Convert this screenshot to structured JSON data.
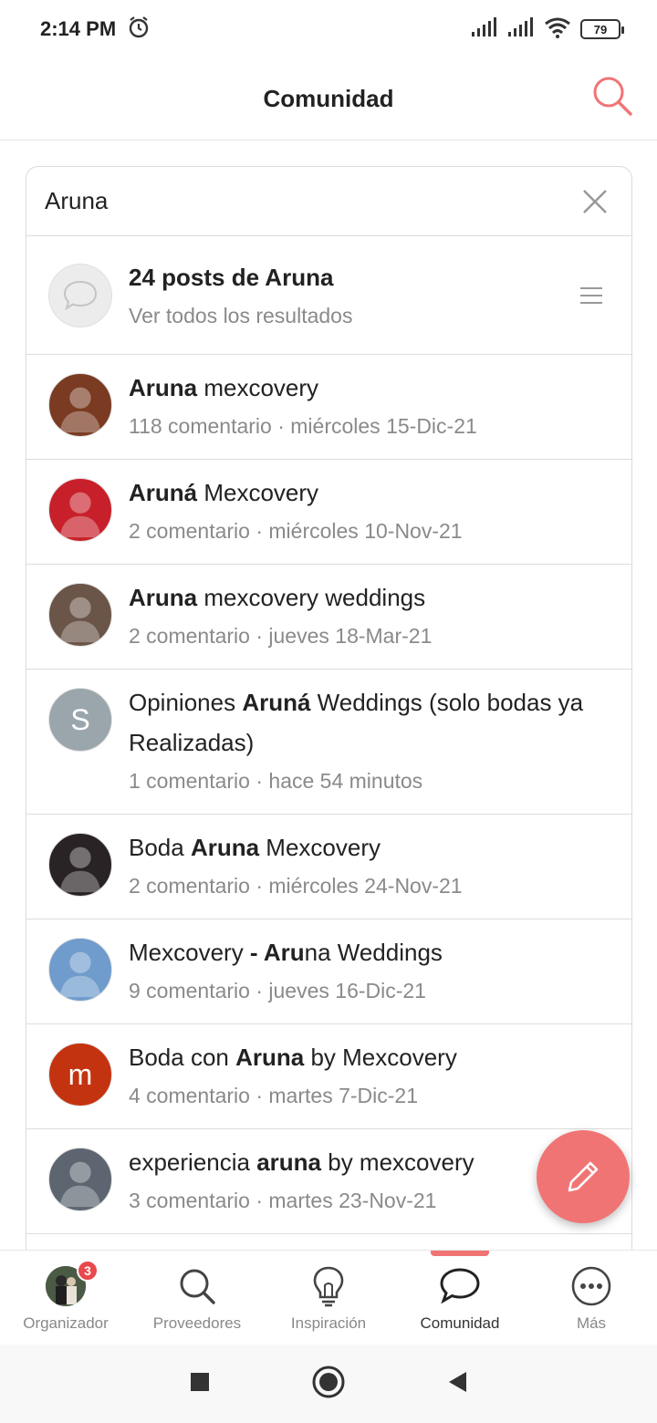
{
  "status_bar": {
    "time": "2:14 PM",
    "battery": "79"
  },
  "header": {
    "title": "Comunidad"
  },
  "search": {
    "value": "Aruna"
  },
  "posts_summary": {
    "title": "24 posts de Aruna",
    "subtitle": "Ver todos los resultados"
  },
  "results": [
    {
      "pre": "",
      "bold": "Aruna",
      "post": " mexcovery",
      "meta": "118 comentario · miércoles 15-Dic-21",
      "avatar_color": "#7a3b22"
    },
    {
      "pre": "",
      "bold": "Aruná",
      "post": " Mexcovery",
      "meta": "2 comentario · miércoles 10-Nov-21",
      "avatar_color": "#c8202a"
    },
    {
      "pre": "",
      "bold": "Aruna",
      "post": " mexcovery weddings",
      "meta": "2 comentario · jueves 18-Mar-21",
      "avatar_color": "#6b5548"
    },
    {
      "pre": "Opiniones ",
      "bold": "Aruná",
      "post": " Weddings (solo bodas ya Realizadas)",
      "meta": "1 comentario · hace 54 minutos",
      "avatar_letter": "S",
      "avatar_color": "#9aa6ab"
    },
    {
      "pre": "Boda ",
      "bold": "Aruna",
      "post": " Mexcovery",
      "meta": "2 comentario · miércoles 24-Nov-21",
      "avatar_color": "#2a2325"
    },
    {
      "pre": "Mexcovery ",
      "bold": "- Aru",
      "post": "na Weddings",
      "meta": "9 comentario · jueves 16-Dic-21",
      "avatar_color": "#6f9ccc"
    },
    {
      "pre": "Boda con ",
      "bold": "Aruna",
      "post": " by Mexcovery",
      "meta": "4 comentario · martes 7-Dic-21",
      "avatar_letter": "m",
      "avatar_color": "#c4330f"
    },
    {
      "pre": "experiencia ",
      "bold": "aruna",
      "post": " by mexcovery",
      "meta": "3 comentario · martes 23-Nov-21",
      "avatar_color": "#5d6670"
    }
  ],
  "bottom_nav": {
    "organizador": "Organizador",
    "badge": "3",
    "proveedores": "Proveedores",
    "inspiracion": "Inspiración",
    "comunidad": "Comunidad",
    "mas": "Más"
  },
  "colors": {
    "accent": "#f17475"
  }
}
